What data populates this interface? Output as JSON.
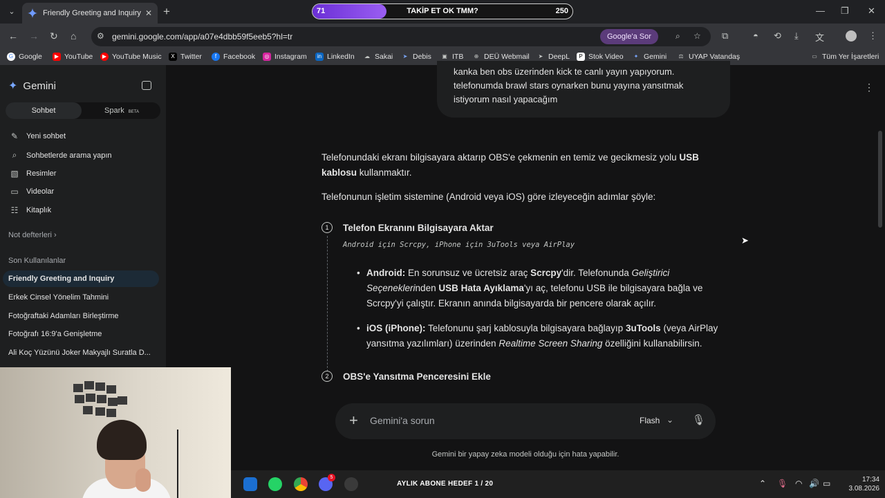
{
  "browser": {
    "tab_title": "Friendly Greeting and Inquiry -",
    "url": "gemini.google.com/app/a07e4dbb59f5eeb5?hl=tr",
    "ask_google": "Google'a Sor",
    "banner": {
      "left": "71",
      "center": "TAKİP ET OK TMM?",
      "right": "250",
      "progress": 0.284
    },
    "bookmarks": [
      "Google",
      "YouTube",
      "YouTube Music",
      "Twitter",
      "Facebook",
      "Instagram",
      "LinkedIn",
      "Sakai",
      "Debis",
      "ITB",
      "DEÜ Webmail",
      "DeepL",
      "Stok Video",
      "Gemini",
      "UYAP Vatandaş"
    ],
    "all_bookmarks": "Tüm Yer İşaretleri"
  },
  "sidebar": {
    "brand": "Gemini",
    "segment": {
      "chat": "Sohbet",
      "spark": "Spark",
      "beta": "BETA"
    },
    "nav": [
      "Yeni sohbet",
      "Sohbetlerde arama yapın",
      "Resimler",
      "Videolar",
      "Kitaplık"
    ],
    "notebooks": "Not defterleri",
    "recent_heading": "Son Kullanılanlar",
    "recent": [
      "Friendly Greeting and Inquiry",
      "Erkek Cinsel Yönelim Tahmini",
      "Fotoğraftaki Adamları Birleştirme",
      "Fotoğrafı 16:9'a Genişletme",
      "Ali Koç Yüzünü Joker Makyajlı Suratla D..."
    ]
  },
  "chat": {
    "user_message": [
      "kanka ben obs üzerinden kick te canlı yayın yapıyorum.",
      "telefonumda brawl stars oynarken bunu yayına yansıtmak",
      "istiyorum nasıl yapacağım"
    ],
    "intro_a": "Telefonundaki ekranı bilgisayara aktarıp OBS'e çekmenin en temiz ve gecikmesiz yolu ",
    "intro_b": "USB kablosu",
    "intro_c": " kullanmaktır.",
    "para2": "Telefonunun işletim sistemine (Android veya iOS) göre izleyeceğin adımlar şöyle:",
    "step1": {
      "num": "1",
      "title": "Telefon Ekranını Bilgisayara Aktar",
      "subtitle": "Android için Scrcpy, iPhone için 3uTools veya AirPlay"
    },
    "android": {
      "label": "Android:",
      "t1": " En sorunsuz ve ücretsiz araç ",
      "b1": "Scrcpy",
      "t2": "'dir. Telefonunda ",
      "i1": "Geliştirici Seçenekleri",
      "t3": "nden ",
      "b2": "USB Hata Ayıklama",
      "t4": "'yı aç, telefonu USB ile bilgisayara bağla ve Scrcpy'yi çalıştır. Ekranın anında bilgisayarda bir pencere olarak açılır."
    },
    "ios": {
      "label": "iOS (iPhone):",
      "t1": " Telefonunu şarj kablosuyla bilgisayara bağlayıp ",
      "b1": "3uTools",
      "t2": " (veya AirPlay yansıtma yazılımları) üzerinden ",
      "i1": "Realtime Screen Sharing",
      "t3": " özelliğini kullanabilirsin."
    },
    "step2": {
      "num": "2",
      "title": "OBS'e Yansıtma Penceresini Ekle"
    },
    "input_placeholder": "Gemini'a sorun",
    "mode": "Flash",
    "disclaimer": "Gemini bir yapay zeka modeli olduğu için hata yapabilir."
  },
  "taskbar": {
    "goal": "AYLIK ABONE HEDEF 1 / 20",
    "discord_badge": "5",
    "time": "17:34",
    "date": "3.08.2026"
  }
}
